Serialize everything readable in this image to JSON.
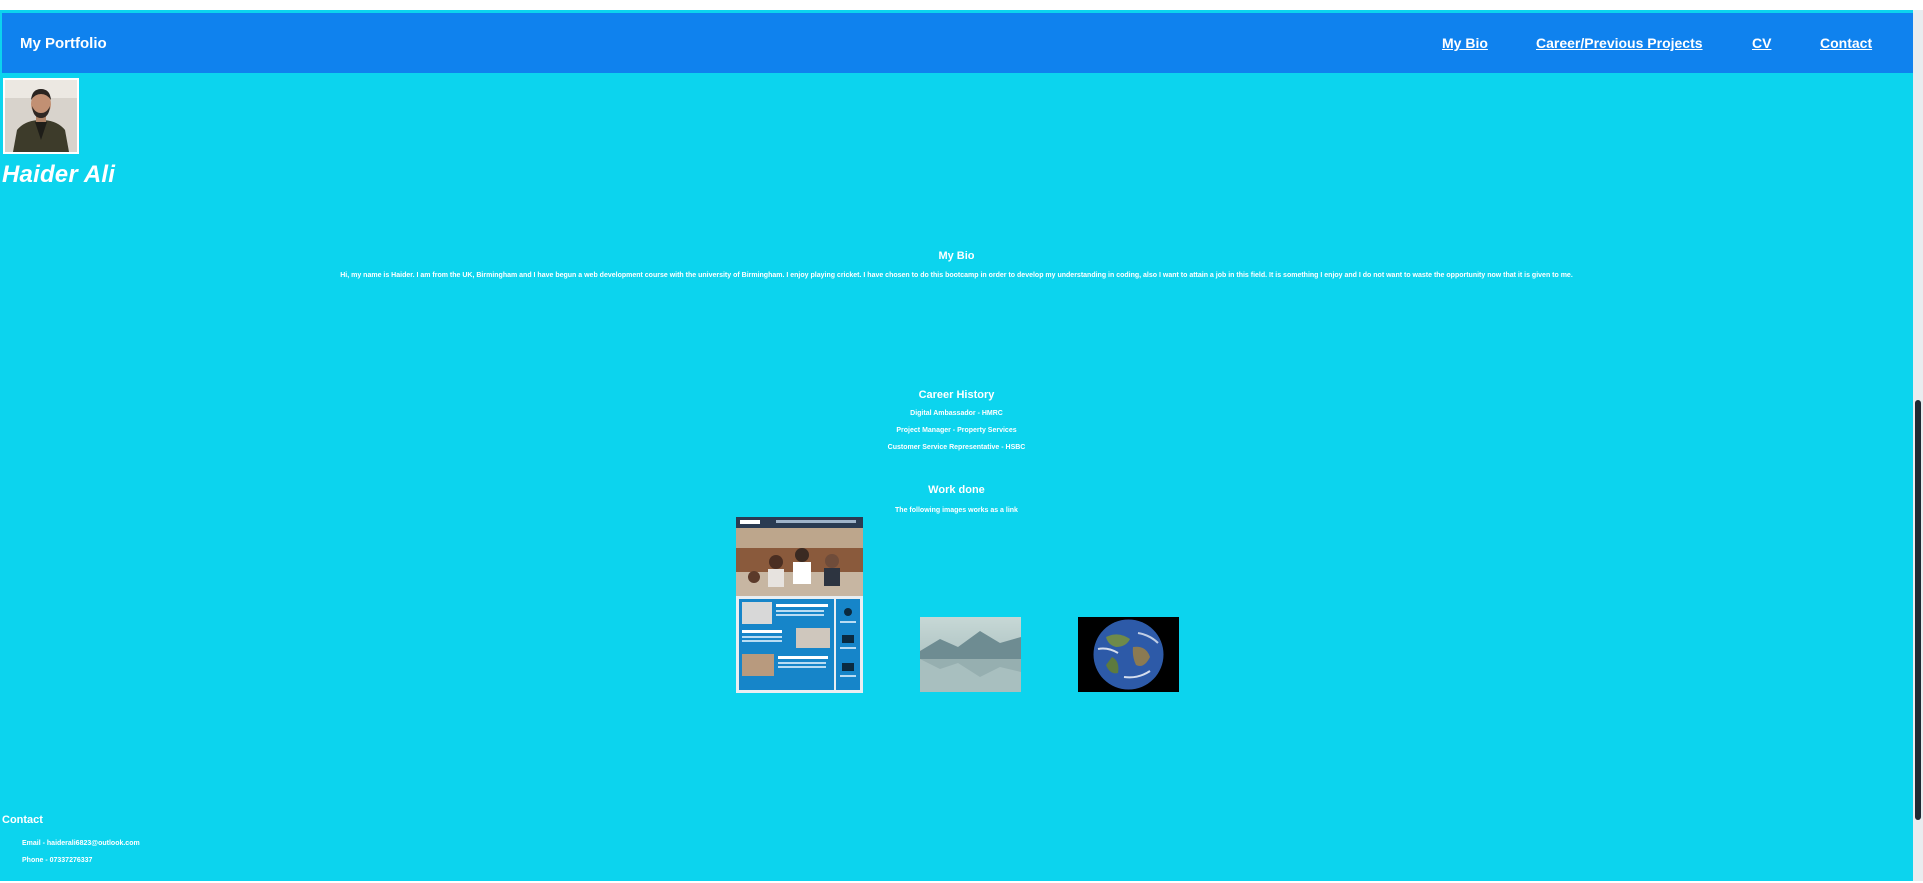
{
  "navbar": {
    "brand": "My Portfolio",
    "links": [
      "My Bio",
      "Career/Previous Projects",
      "CV",
      "Contact"
    ]
  },
  "profile": {
    "name": "Haider Ali"
  },
  "bio": {
    "title": "My Bio",
    "text": "Hi, my name is Haider. I am from the UK, Birmingham and I have begun a web development course with the university of Birmingham. I enjoy playing cricket. I have chosen to do this bootcamp in order to develop my understanding in coding, also I want to attain a job in this field. It is something I enjoy and I do not want to waste the opportunity now that it is given to me."
  },
  "career": {
    "title": "Career History",
    "items": [
      "Digital Ambassador - HMRC",
      "Project Manager - Property Services",
      "Customer Service Representative - HSBC"
    ]
  },
  "work": {
    "title": "Work done",
    "subtitle": "The following images works as a link"
  },
  "contact": {
    "title": "Contact",
    "email": "Email - haiderali6823@outlook.com",
    "phone": "Phone - 07337276337"
  },
  "colors": {
    "page_bg": "#0cd4ee",
    "navbar_bg": "#0f82ee",
    "text": "#ffffff"
  },
  "icons": {
    "avatar": "person-photo",
    "work_1": "website-screenshot",
    "work_2": "misty-landscape",
    "work_3": "earth-globe"
  }
}
